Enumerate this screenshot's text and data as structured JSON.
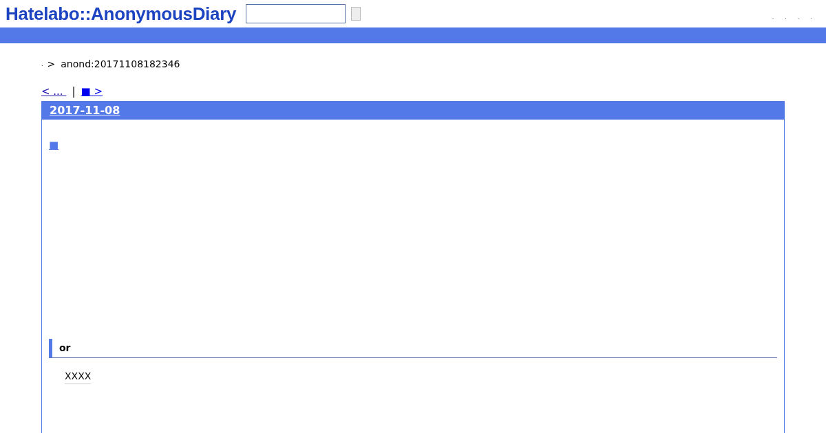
{
  "header": {
    "logo": "Hatelabo::AnonymousDiary",
    "nav_links": [
      ".",
      ".",
      ".",
      "."
    ]
  },
  "breadcrumb": {
    "home": ".",
    "separator": ">",
    "current": "anond:20171108182346"
  },
  "pager": {
    "prev": "< ... ",
    "divider": "|",
    "next": "■ >"
  },
  "entry": {
    "date": "2017-11-08",
    "title_link": "■",
    "section": {
      "heading": "or",
      "keyword": "XXXX"
    }
  }
}
